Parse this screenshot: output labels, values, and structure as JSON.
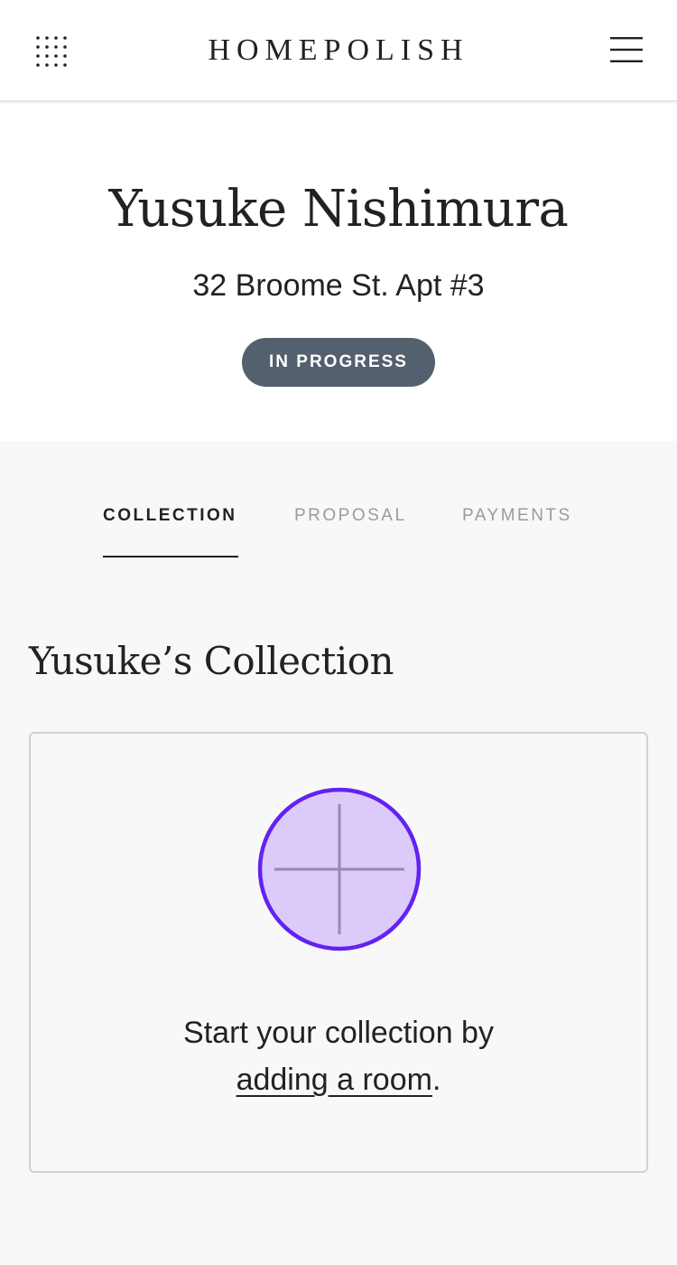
{
  "header": {
    "brand": "HOMEPOLISH",
    "apps_icon": "grid-dots-icon",
    "menu_icon": "hamburger-menu-icon"
  },
  "client": {
    "name": "Yusuke Nishimura",
    "address": "32 Broome St. Apt #3",
    "status": "IN PROGRESS",
    "status_color": "#54606d"
  },
  "tabs": [
    {
      "label": "COLLECTION",
      "active": true
    },
    {
      "label": "PROPOSAL",
      "active": false
    },
    {
      "label": "PAYMENTS",
      "active": false
    }
  ],
  "collection": {
    "title": "Yusuke’s Collection",
    "empty_text_before": "Start your collection by",
    "empty_link": "adding a room",
    "empty_text_after": ".",
    "add_icon": "plus-circle-icon",
    "accent_color": "#6322f2",
    "accent_fill": "#dccbfa"
  }
}
